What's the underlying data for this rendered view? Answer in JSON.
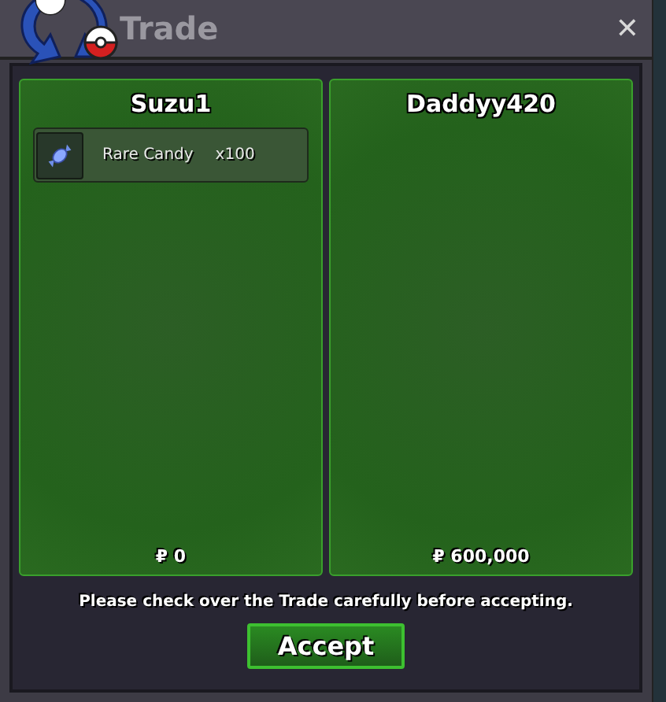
{
  "window": {
    "title": "Trade",
    "close": "✕"
  },
  "offers": [
    {
      "player": "Suzu1",
      "items": [
        {
          "name": "Rare Candy",
          "quantity": "x100"
        }
      ],
      "money": "₽ 0"
    },
    {
      "player": "Daddyy420",
      "money": "₽ 600,000"
    }
  ],
  "message": "Please check over the Trade carefully before accepting.",
  "accept_button": "Accept"
}
